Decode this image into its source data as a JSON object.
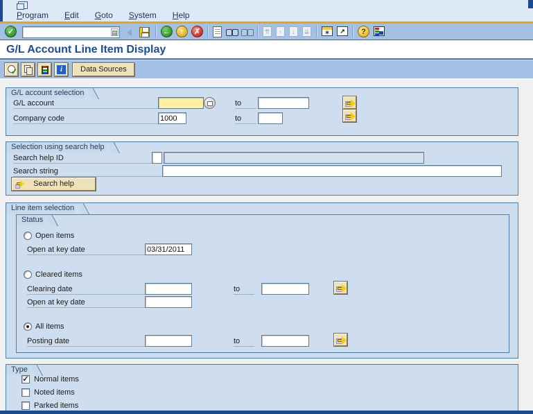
{
  "window": {
    "menu_items": [
      {
        "label": "Program"
      },
      {
        "label": "Edit"
      },
      {
        "label": "Goto"
      },
      {
        "label": "System"
      },
      {
        "label": "Help"
      }
    ],
    "command_field": {
      "value": ""
    },
    "icon_glyphs": {
      "enter": "✓",
      "back": "←",
      "exit": "↑",
      "cancel": "✗",
      "help": "?",
      "dropdown": "▤",
      "first_page": "⇈",
      "prev_page": "↑",
      "next_page": "↓",
      "last_page": "⇊",
      "new_session": "✶",
      "shortcut": "↗",
      "info": "i",
      "execute_check": "✓"
    },
    "colors": {
      "accent_orange": "#F5A300",
      "band_blue": "#A3C1E4",
      "menu_bg": "#DEE9F8",
      "group_fill": "#CEDEEE",
      "group_border": "#4E7CA8",
      "focus_yellow": "#FEF0A0",
      "button_tan": "#F0E2B8",
      "title_blue": "#1C4B9A",
      "window_navy": "#1B4A8F"
    }
  },
  "page": {
    "title": "G/L Account Line Item Display"
  },
  "app_toolbar": {
    "data_sources_label": "Data Sources"
  },
  "sections": {
    "gl_account_selection": {
      "title": "G/L account selection",
      "gl_account": {
        "label": "G/L account",
        "value": "",
        "focused": true,
        "to_label": "to",
        "to_value": ""
      },
      "company_code": {
        "label": "Company code",
        "value": "1000",
        "to_label": "to",
        "to_value": ""
      }
    },
    "search_help": {
      "title": "Selection using search help",
      "search_help_id": {
        "label": "Search help ID",
        "value": "",
        "display_value": ""
      },
      "search_string": {
        "label": "Search string",
        "value": ""
      },
      "search_help_button_label": "Search help"
    },
    "line_item_selection": {
      "title": "Line item selection",
      "status": {
        "title": "Status",
        "open_items": {
          "label": "Open items",
          "selected": false
        },
        "open_at_key_date": {
          "label": "Open at key date",
          "value": "03/31/2011"
        },
        "cleared_items": {
          "label": "Cleared items",
          "selected": false
        },
        "clearing_date": {
          "label": "Clearing date",
          "value": "",
          "to_label": "to",
          "to_value": ""
        },
        "open_at_key_date_cleared": {
          "label": "Open at key date",
          "value": ""
        },
        "all_items": {
          "label": "All items",
          "selected": true
        },
        "posting_date": {
          "label": "Posting date",
          "value": "",
          "to_label": "to",
          "to_value": ""
        }
      }
    },
    "type": {
      "title": "Type",
      "normal_items": {
        "label": "Normal items",
        "checked": true
      },
      "noted_items": {
        "label": "Noted items",
        "checked": false
      },
      "parked_items": {
        "label": "Parked items",
        "checked": false
      }
    }
  }
}
